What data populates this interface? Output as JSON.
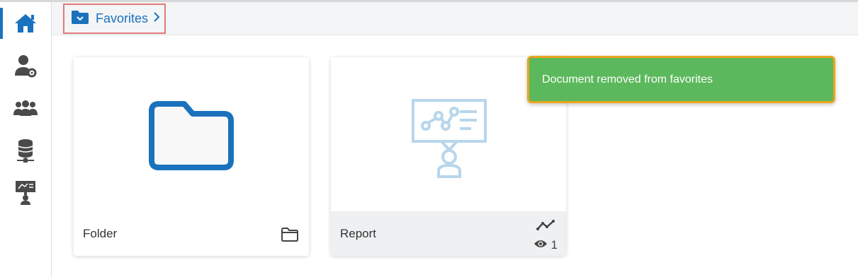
{
  "breadcrumb": {
    "label": "Favorites"
  },
  "sidebar": {
    "items": [
      {
        "icon": "home-icon",
        "active": true
      },
      {
        "icon": "user-settings-icon",
        "active": false
      },
      {
        "icon": "users-group-icon",
        "active": false
      },
      {
        "icon": "database-icon",
        "active": false
      },
      {
        "icon": "presentation-icon",
        "active": false
      }
    ]
  },
  "cards": [
    {
      "label": "Folder",
      "type_icon": "folder-outline-icon"
    },
    {
      "label": "Report",
      "type_icon": "line-chart-icon",
      "views": "1"
    }
  ],
  "toast": {
    "message": "Document removed from favorites"
  },
  "colors": {
    "accent": "#1a72bd",
    "toast_bg": "#5cb85c",
    "toast_border": "#e9a51e",
    "crumb_highlight": "#e07a7a"
  }
}
